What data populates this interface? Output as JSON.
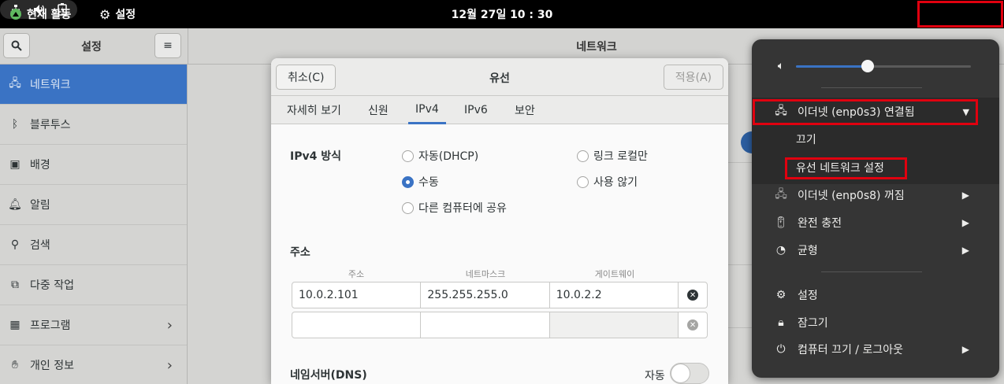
{
  "topbar": {
    "activities": "현재 활동",
    "app_name": "설정",
    "clock": "12월 27일  10 : 30"
  },
  "sidebar": {
    "title": "설정",
    "items": [
      {
        "label": "네트워크",
        "icon": "network-icon",
        "active": true
      },
      {
        "label": "블루투스",
        "icon": "bluetooth-icon"
      },
      {
        "label": "배경",
        "icon": "background-icon"
      },
      {
        "label": "알림",
        "icon": "bell-icon"
      },
      {
        "label": "검색",
        "icon": "search-icon"
      },
      {
        "label": "다중 작업",
        "icon": "multitasking-icon"
      },
      {
        "label": "프로그램",
        "icon": "apps-grid-icon",
        "chevron": true
      },
      {
        "label": "개인 정보",
        "icon": "hand-icon",
        "chevron": true
      }
    ]
  },
  "main": {
    "title": "네트워크"
  },
  "dialog": {
    "cancel": "취소(C)",
    "title": "유선",
    "apply": "적용(A)",
    "tabs": [
      "자세히 보기",
      "신원",
      "IPv4",
      "IPv6",
      "보안"
    ],
    "active_tab": "IPv4",
    "method_label": "IPv4 방식",
    "methods": {
      "auto": "자동(DHCP)",
      "link_local": "링크 로컬만",
      "manual": "수동",
      "disable": "사용 않기",
      "shared": "다른 컴퓨터에 공유"
    },
    "selected_method": "수동",
    "address_section": "주소",
    "columns": [
      "주소",
      "네트마스크",
      "게이트웨이"
    ],
    "rows": [
      {
        "address": "10.0.2.101",
        "netmask": "255.255.255.0",
        "gateway": "10.0.2.2"
      },
      {
        "address": "",
        "netmask": "",
        "gateway": ""
      }
    ],
    "dns_label": "네임서버(DNS)",
    "dns_auto_label": "자동",
    "dns_auto_on": false
  },
  "system_menu": {
    "volume_level": 0.41,
    "items": {
      "eth0": "이더넷 (enp0s3) 연결됨",
      "off": "끄기",
      "wired_settings": "유선 네트워크 설정",
      "eth1": "이더넷 (enp0s8) 꺼짐",
      "battery": "완전 충전",
      "power_mode": "균형",
      "settings": "설정",
      "lock": "잠그기",
      "power": "컴퓨터 끄기 / 로그아웃"
    }
  },
  "colors": {
    "accent": "#3a73c4",
    "highlight_box": "#e0000f"
  }
}
